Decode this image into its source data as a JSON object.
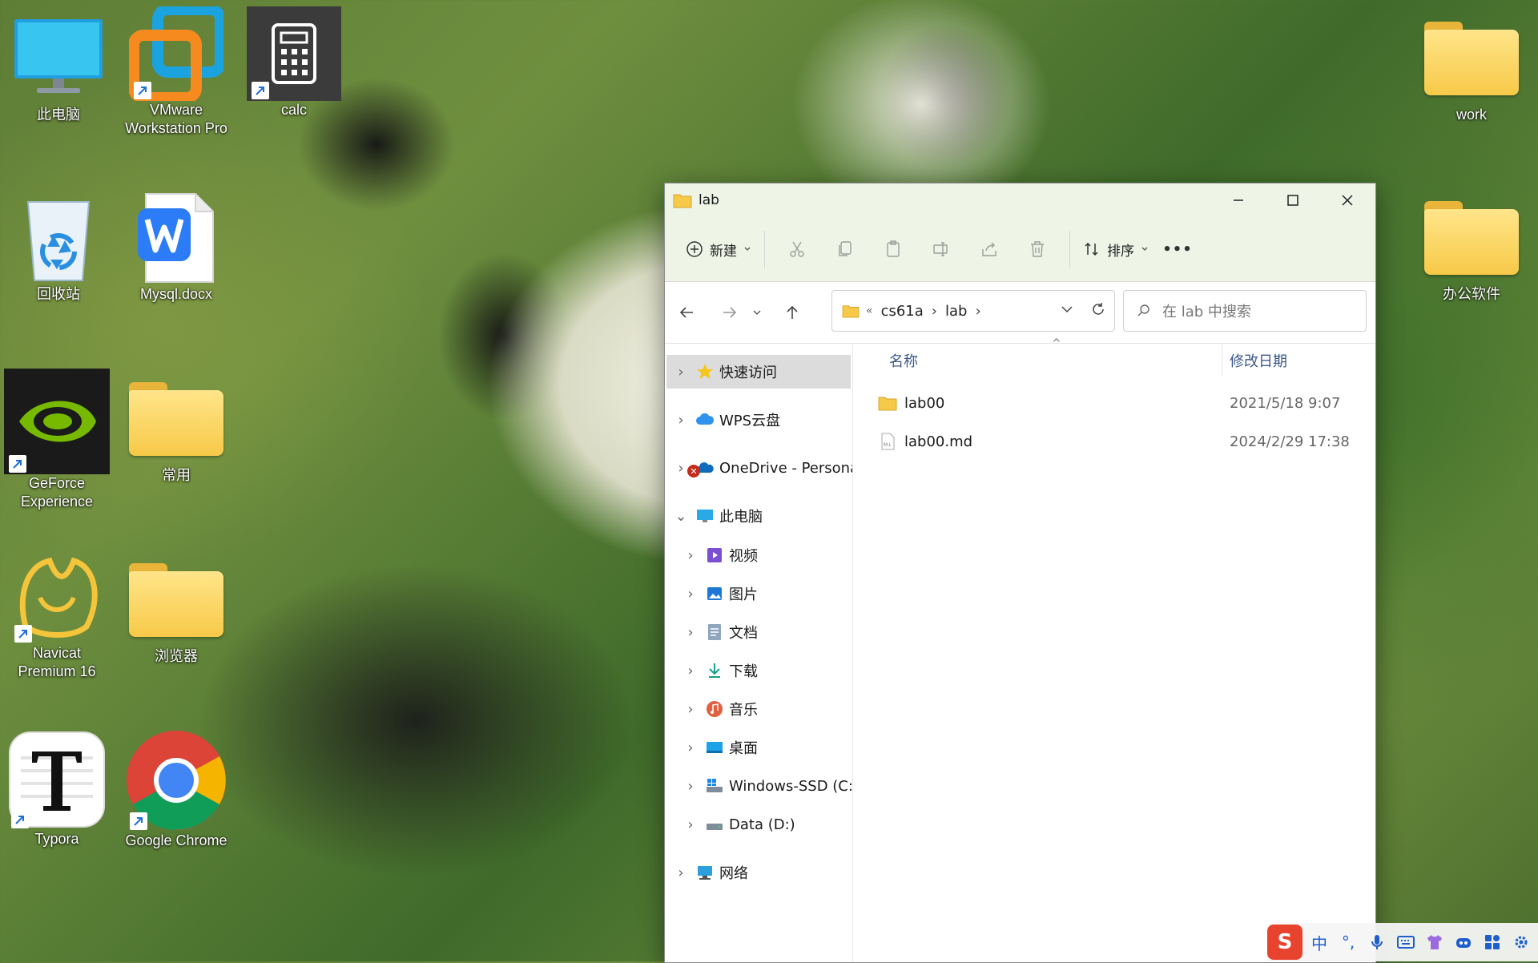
{
  "desktop": {
    "icons": [
      {
        "label": "此电脑"
      },
      {
        "label": "VMware Workstation Pro"
      },
      {
        "label": "calc"
      },
      {
        "label": "work"
      },
      {
        "label": "回收站"
      },
      {
        "label": "Mysql.docx"
      },
      {
        "label": "办公软件"
      },
      {
        "label": "GeForce Experience"
      },
      {
        "label": "常用"
      },
      {
        "label": "Navicat Premium 16"
      },
      {
        "label": "浏览器"
      },
      {
        "label": "Typora"
      },
      {
        "label": "Google Chrome"
      }
    ]
  },
  "window": {
    "title": "lab",
    "toolbar": {
      "new_label": "新建",
      "sort_label": "排序",
      "more_label": "•••"
    },
    "address": {
      "overflow": "«",
      "crumbs": [
        "cs61a",
        "lab"
      ]
    },
    "search": {
      "placeholder": "在 lab 中搜索"
    },
    "nav": {
      "items": [
        {
          "label": "快速访问",
          "selected": true
        },
        {
          "label": "WPS云盘"
        },
        {
          "label": "OneDrive - Personal"
        },
        {
          "label": "此电脑"
        },
        {
          "label": "视频"
        },
        {
          "label": "图片"
        },
        {
          "label": "文档"
        },
        {
          "label": "下载"
        },
        {
          "label": "音乐"
        },
        {
          "label": "桌面"
        },
        {
          "label": "Windows-SSD (C:)"
        },
        {
          "label": "Data (D:)"
        },
        {
          "label": "网络"
        }
      ]
    },
    "columns": {
      "name": "名称",
      "modified": "修改日期"
    },
    "files": [
      {
        "name": "lab00",
        "type": "folder",
        "modified": "2021/5/18 9:07"
      },
      {
        "name": "lab00.md",
        "type": "md-file",
        "modified": "2024/2/29 17:38"
      }
    ]
  },
  "tray": {
    "ime_label": "中",
    "punct_label": "°,"
  },
  "colors": {
    "folder": "#f7c948",
    "accent": "#0067c0",
    "titlebar": "#eef4e6"
  }
}
